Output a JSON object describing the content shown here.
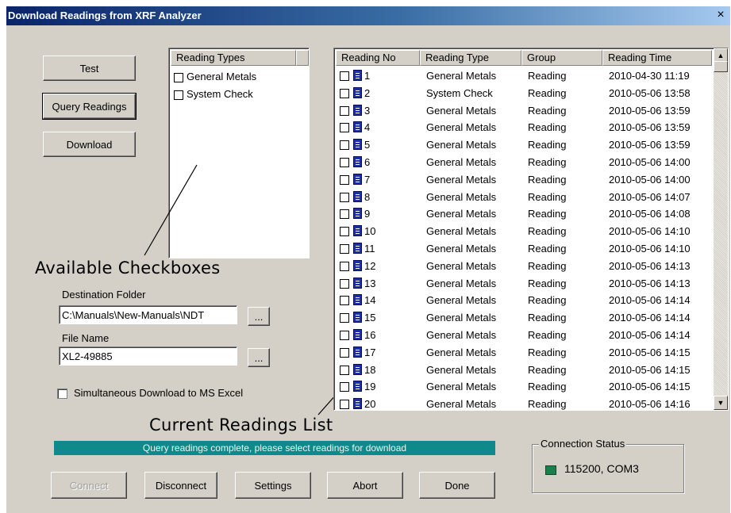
{
  "window": {
    "title": "Download Readings from XRF Analyzer",
    "close": "×"
  },
  "buttons": {
    "test": "Test",
    "query": "Query Readings",
    "download": "Download",
    "browse_folder": "...",
    "browse_file": "...",
    "connect": "Connect",
    "disconnect": "Disconnect",
    "settings": "Settings",
    "abort": "Abort",
    "done": "Done"
  },
  "reading_types": {
    "header": "Reading Types",
    "items": [
      "General Metals",
      "System Check"
    ]
  },
  "annotations": {
    "available_checkboxes": "Available Checkboxes",
    "current_readings_list": "Current Readings List"
  },
  "destination": {
    "label": "Destination Folder",
    "value": "C:\\Manuals\\New-Manuals\\NDT"
  },
  "file": {
    "label": "File Name",
    "value": "XL2-49885"
  },
  "excel": {
    "label": "Simultaneous Download to MS Excel"
  },
  "status": {
    "message": "Query readings complete, please select readings for download"
  },
  "connection": {
    "title": "Connection Status",
    "value": "115200, COM3",
    "indicator_color": "#1a7f4c"
  },
  "readings": {
    "columns": [
      "Reading No",
      "Reading Type",
      "Group",
      "Reading Time"
    ],
    "rows": [
      [
        "1",
        "General Metals",
        "Reading",
        "2010-04-30 11:19"
      ],
      [
        "2",
        "System Check",
        "Reading",
        "2010-05-06 13:58"
      ],
      [
        "3",
        "General Metals",
        "Reading",
        "2010-05-06 13:59"
      ],
      [
        "4",
        "General Metals",
        "Reading",
        "2010-05-06 13:59"
      ],
      [
        "5",
        "General Metals",
        "Reading",
        "2010-05-06 13:59"
      ],
      [
        "6",
        "General Metals",
        "Reading",
        "2010-05-06 14:00"
      ],
      [
        "7",
        "General Metals",
        "Reading",
        "2010-05-06 14:00"
      ],
      [
        "8",
        "General Metals",
        "Reading",
        "2010-05-06 14:07"
      ],
      [
        "9",
        "General Metals",
        "Reading",
        "2010-05-06 14:08"
      ],
      [
        "10",
        "General Metals",
        "Reading",
        "2010-05-06 14:10"
      ],
      [
        "11",
        "General Metals",
        "Reading",
        "2010-05-06 14:10"
      ],
      [
        "12",
        "General Metals",
        "Reading",
        "2010-05-06 14:13"
      ],
      [
        "13",
        "General Metals",
        "Reading",
        "2010-05-06 14:13"
      ],
      [
        "14",
        "General Metals",
        "Reading",
        "2010-05-06 14:14"
      ],
      [
        "15",
        "General Metals",
        "Reading",
        "2010-05-06 14:14"
      ],
      [
        "16",
        "General Metals",
        "Reading",
        "2010-05-06 14:14"
      ],
      [
        "17",
        "General Metals",
        "Reading",
        "2010-05-06 14:15"
      ],
      [
        "18",
        "General Metals",
        "Reading",
        "2010-05-06 14:15"
      ],
      [
        "19",
        "General Metals",
        "Reading",
        "2010-05-06 14:15"
      ],
      [
        "20",
        "General Metals",
        "Reading",
        "2010-05-06 14:16"
      ]
    ]
  }
}
